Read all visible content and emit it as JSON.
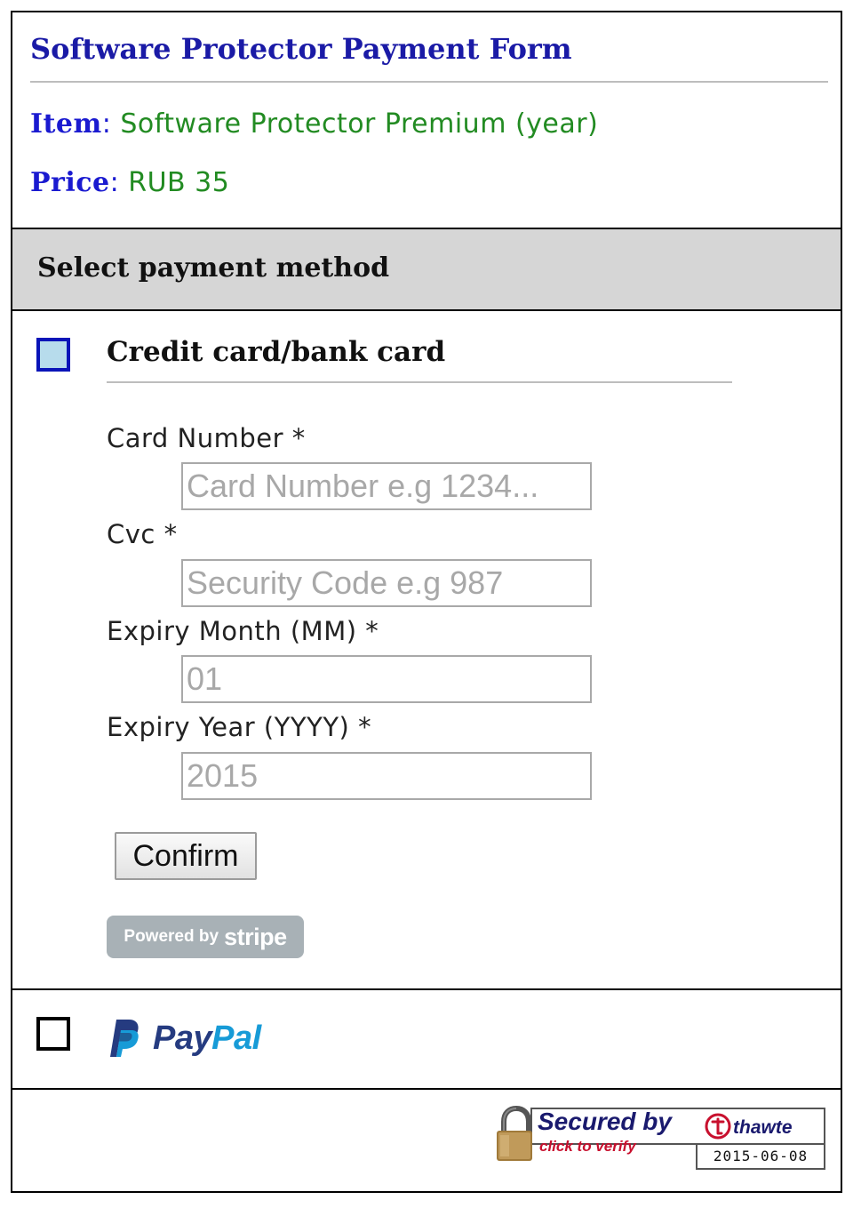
{
  "form": {
    "title": "Software Protector Payment Form",
    "item_label": "Item",
    "item_value": "Software Protector Premium (year)",
    "price_label": "Price",
    "price_value": "RUB 35"
  },
  "payment": {
    "section_title": "Select payment method",
    "credit_card": {
      "title": "Credit card/bank card",
      "selected": true,
      "fields": {
        "card_number": {
          "label": "Card Number *",
          "placeholder": "Card Number e.g 1234...",
          "value": ""
        },
        "cvc": {
          "label": "Cvc *",
          "placeholder": "Security Code e.g 987",
          "value": ""
        },
        "expiry_month": {
          "label": "Expiry Month (MM) *",
          "placeholder": "01",
          "value": ""
        },
        "expiry_year": {
          "label": "Expiry Year (YYYY) *",
          "placeholder": "2015",
          "value": ""
        }
      },
      "confirm_label": "Confirm",
      "stripe_badge": {
        "powered_by": "Powered by",
        "brand": "stripe"
      }
    },
    "paypal": {
      "selected": false,
      "logo_pay": "Pay",
      "logo_pal": "Pal"
    }
  },
  "seal": {
    "secured_by": "Secured by",
    "click_to_verify": "click to verify",
    "brand": "thawte",
    "date": "2015-06-08"
  },
  "colors": {
    "title_blue": "#1a1aa6",
    "label_blue": "#1a1ad0",
    "value_green": "#228b22",
    "section_gray": "#d6d6d6",
    "selected_checkbox_fill": "#b7dcec",
    "selected_checkbox_border": "#0a14b8",
    "stripe_badge": "#a8b1b6",
    "paypal_dark": "#253b80",
    "paypal_light": "#179bd7",
    "thawte_red": "#c8102e"
  },
  "icons": [
    "checkbox-checked-icon",
    "checkbox-empty-icon",
    "paypal-p-icon",
    "padlock-icon",
    "thawte-t-icon"
  ]
}
